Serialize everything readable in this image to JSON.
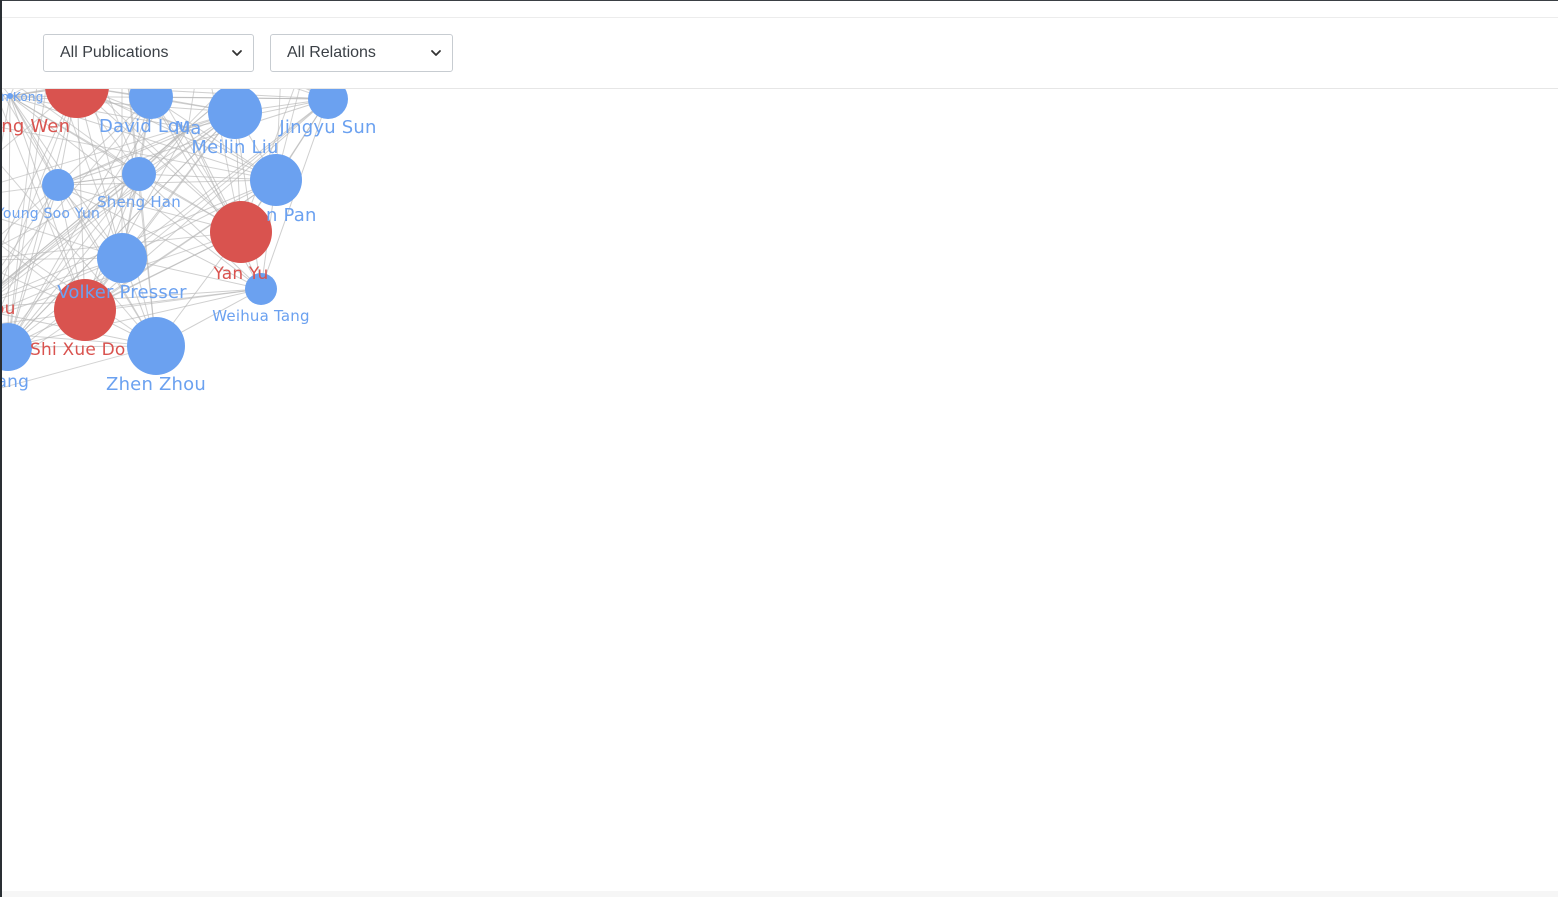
{
  "filters": {
    "publications": {
      "selected": "All Publications"
    },
    "relations": {
      "selected": "All Relations"
    }
  },
  "colors": {
    "highlight": "#d9534f",
    "default": "#6ba1f0",
    "edge": "#b5b5b5"
  },
  "graph": {
    "nodes": [
      {
        "id": "kong",
        "label": "ain Kong",
        "group": "default"
      },
      {
        "id": "wen",
        "label": "ong Wen",
        "group": "highlight"
      },
      {
        "id": "david",
        "label": "David Lou",
        "group": "default"
      },
      {
        "id": "ma",
        "label": "Ma",
        "group": "default"
      },
      {
        "id": "meilin",
        "label": "Meilin Liu",
        "group": "default"
      },
      {
        "id": "jingyu",
        "label": "Jingyu Sun",
        "group": "default"
      },
      {
        "id": "soo",
        "label": "Young Soo Yun",
        "group": "default"
      },
      {
        "id": "sheng",
        "label": "Sheng Han",
        "group": "default"
      },
      {
        "id": "pan",
        "label": "n Pan",
        "group": "default"
      },
      {
        "id": "yanyu",
        "label": "Yan Yu",
        "group": "highlight"
      },
      {
        "id": "volker",
        "label": "Volker Presser",
        "group": "default"
      },
      {
        "id": "weihua",
        "label": "Weihua Tang",
        "group": "default"
      },
      {
        "id": "ou",
        "label": "ou",
        "group": "highlight"
      },
      {
        "id": "shixue",
        "label": "Shi Xue Do",
        "group": "highlight"
      },
      {
        "id": "pang",
        "label": "Pang",
        "group": "default"
      },
      {
        "id": "zhen",
        "label": "Zhen Zhou",
        "group": "default"
      }
    ]
  }
}
